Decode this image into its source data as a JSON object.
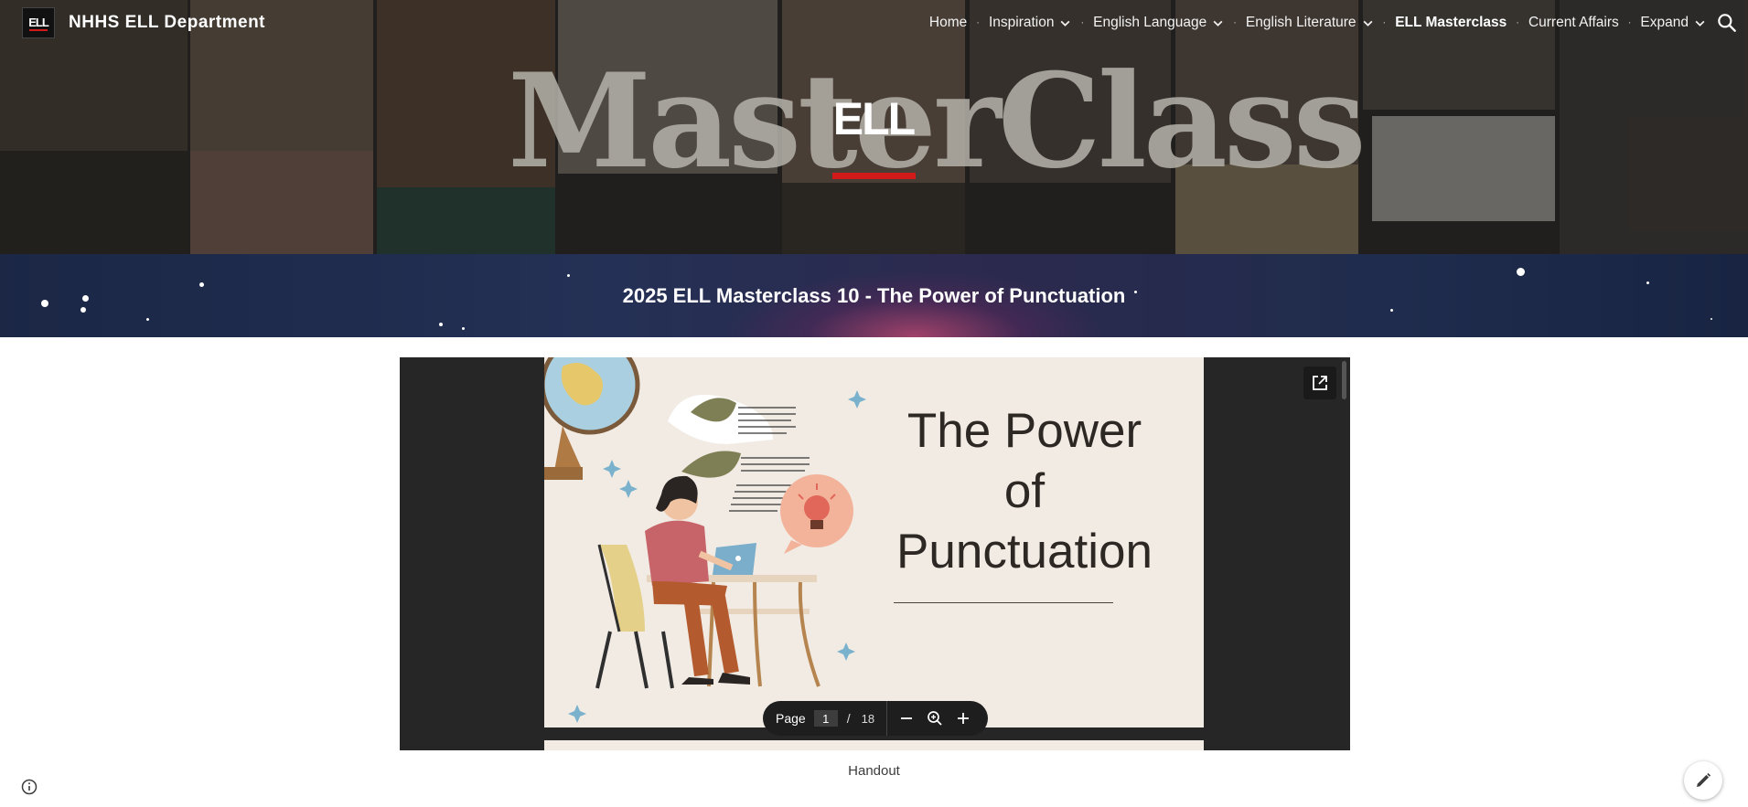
{
  "site": {
    "logo_text": "ELL",
    "title": "NHHS ELL Department"
  },
  "nav": {
    "items": [
      {
        "label": "Home",
        "dropdown": false,
        "active": false
      },
      {
        "label": "Inspiration",
        "dropdown": true,
        "active": false
      },
      {
        "label": "English Language",
        "dropdown": true,
        "active": false
      },
      {
        "label": "English Literature",
        "dropdown": true,
        "active": false
      },
      {
        "label": "ELL Masterclass",
        "dropdown": false,
        "active": true
      },
      {
        "label": "Current Affairs",
        "dropdown": false,
        "active": false
      },
      {
        "label": "Expand",
        "dropdown": true,
        "active": false
      }
    ],
    "separator": "·",
    "search_icon": "search-icon"
  },
  "banner": {
    "masterclass_text": "MasterClass",
    "ell_overlay": "ELL",
    "accent_color": "#d11a1a"
  },
  "page": {
    "heading": "2025 ELL Masterclass 10 - The Power of Punctuation"
  },
  "viewer": {
    "slide_title": "The Power of Punctuation",
    "slide_title_lines": [
      "The Power",
      "of",
      "Punctuation"
    ],
    "toolbar": {
      "page_label": "Page",
      "current_page": "1",
      "separator": "/",
      "total_pages": "18"
    },
    "popout_icon": "open-in-new-icon"
  },
  "caption": "Handout",
  "footer": {
    "info_icon": "info-icon",
    "edit_icon": "pencil-icon"
  }
}
